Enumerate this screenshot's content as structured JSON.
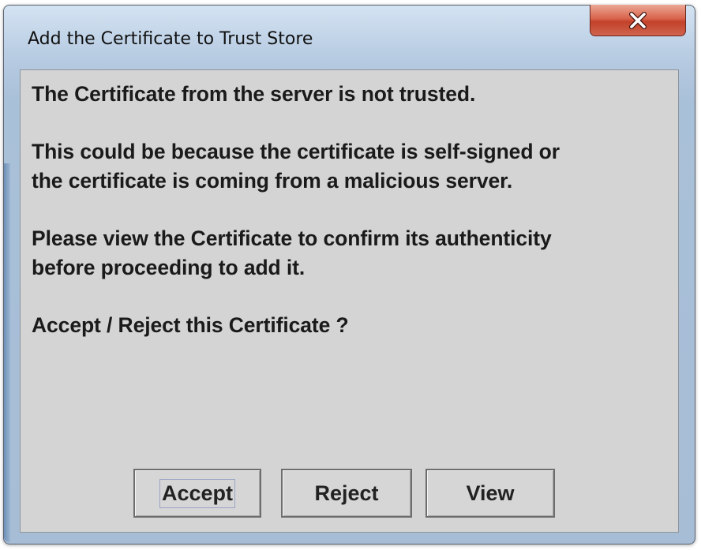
{
  "window": {
    "title": "Add the Certificate to Trust Store",
    "close_glyph": "X"
  },
  "message": {
    "line1": "The Certificate from the server is not trusted.",
    "line2a": "This could be because the certificate is self-signed or",
    "line2b": "the certificate is coming from a malicious server.",
    "line3a": "Please view the Certificate to confirm its authenticity",
    "line3b": "before proceeding to add it.",
    "line4": "Accept / Reject this Certificate ?"
  },
  "buttons": {
    "accept_label": "Accept",
    "reject_label": "Reject",
    "view_label": "View",
    "focused": "Accept"
  },
  "icons": {
    "close": "close-icon"
  },
  "colors": {
    "close_button": "#c9503a",
    "dialog_background": "#d4d4d4",
    "title_bar": "#b9cde3"
  }
}
